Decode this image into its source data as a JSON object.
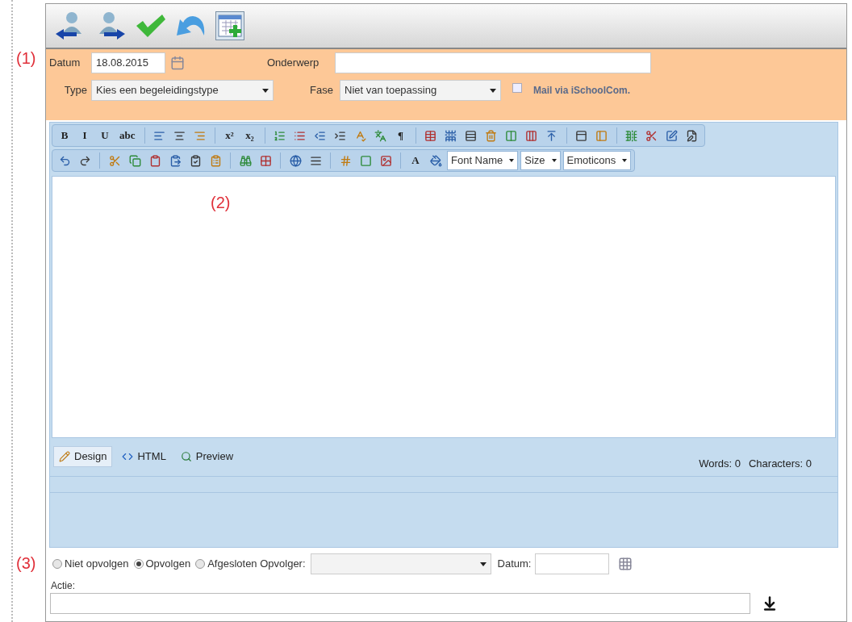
{
  "annotations": [
    {
      "label": "(1)"
    },
    {
      "label": "(2)"
    },
    {
      "label": "(3)"
    }
  ],
  "header": {
    "datum_label": "Datum",
    "datum_value": "18.08.2015",
    "onderwerp_label": "Onderwerp",
    "type_label": "Type",
    "type_value": "Kies een begeleidingstype",
    "fase_label": "Fase",
    "fase_value": "Niet van toepassing",
    "mail": {
      "label": "Mail via iSchoolCom.",
      "checked": false
    }
  },
  "editor_toolbar": [
    [
      {
        "kind": "text",
        "label": "B"
      },
      {
        "kind": "text",
        "label": "I"
      },
      {
        "kind": "text",
        "label": "U"
      },
      {
        "kind": "text",
        "label": "abc"
      },
      {
        "kind": "sep"
      },
      {
        "kind": "icon"
      },
      {
        "kind": "icon"
      },
      {
        "kind": "icon"
      },
      {
        "kind": "sep"
      },
      {
        "kind": "text",
        "label": "x²"
      },
      {
        "kind": "text",
        "label": "x₂"
      },
      {
        "kind": "sep"
      },
      {
        "kind": "icon"
      },
      {
        "kind": "icon"
      },
      {
        "kind": "icon"
      },
      {
        "kind": "icon"
      },
      {
        "kind": "icon"
      },
      {
        "kind": "icon"
      },
      {
        "kind": "text",
        "label": "¶"
      },
      {
        "kind": "sep"
      },
      {
        "kind": "icon"
      },
      {
        "kind": "icon"
      },
      {
        "kind": "icon"
      },
      {
        "kind": "icon"
      },
      {
        "kind": "icon"
      },
      {
        "kind": "icon"
      },
      {
        "kind": "icon"
      },
      {
        "kind": "sep"
      },
      {
        "kind": "icon"
      },
      {
        "kind": "icon"
      },
      {
        "kind": "sep"
      },
      {
        "kind": "icon"
      },
      {
        "kind": "icon"
      },
      {
        "kind": "icon"
      },
      {
        "kind": "icon"
      }
    ],
    [
      {
        "kind": "icon"
      },
      {
        "kind": "icon"
      },
      {
        "kind": "sep"
      },
      {
        "kind": "icon"
      },
      {
        "kind": "icon"
      },
      {
        "kind": "icon"
      },
      {
        "kind": "icon"
      },
      {
        "kind": "icon"
      },
      {
        "kind": "icon"
      },
      {
        "kind": "sep"
      },
      {
        "kind": "icon"
      },
      {
        "kind": "icon"
      },
      {
        "kind": "sep"
      },
      {
        "kind": "icon"
      },
      {
        "kind": "icon"
      },
      {
        "kind": "sep"
      },
      {
        "kind": "icon"
      },
      {
        "kind": "icon"
      },
      {
        "kind": "icon"
      },
      {
        "kind": "sep"
      },
      {
        "kind": "text",
        "label": "A"
      },
      {
        "kind": "icon"
      },
      {
        "kind": "select",
        "label": "Font Name"
      },
      {
        "kind": "select",
        "label": "Size"
      },
      {
        "kind": "select",
        "label": "Emoticons"
      }
    ]
  ],
  "modes": [
    {
      "label": "Design",
      "selected": true
    },
    {
      "label": "HTML",
      "selected": false
    },
    {
      "label": "Preview",
      "selected": false
    }
  ],
  "counts": {
    "words": "Words: 0",
    "characters": "Characters: 0"
  },
  "follow_up": {
    "options": [
      {
        "label": "Niet opvolgen",
        "selected": false
      },
      {
        "label": "Opvolgen",
        "selected": true
      },
      {
        "label": "Afgesloten Opvolger:",
        "selected": false
      }
    ],
    "datum_label": "Datum:",
    "actie_label": "Actie:"
  }
}
